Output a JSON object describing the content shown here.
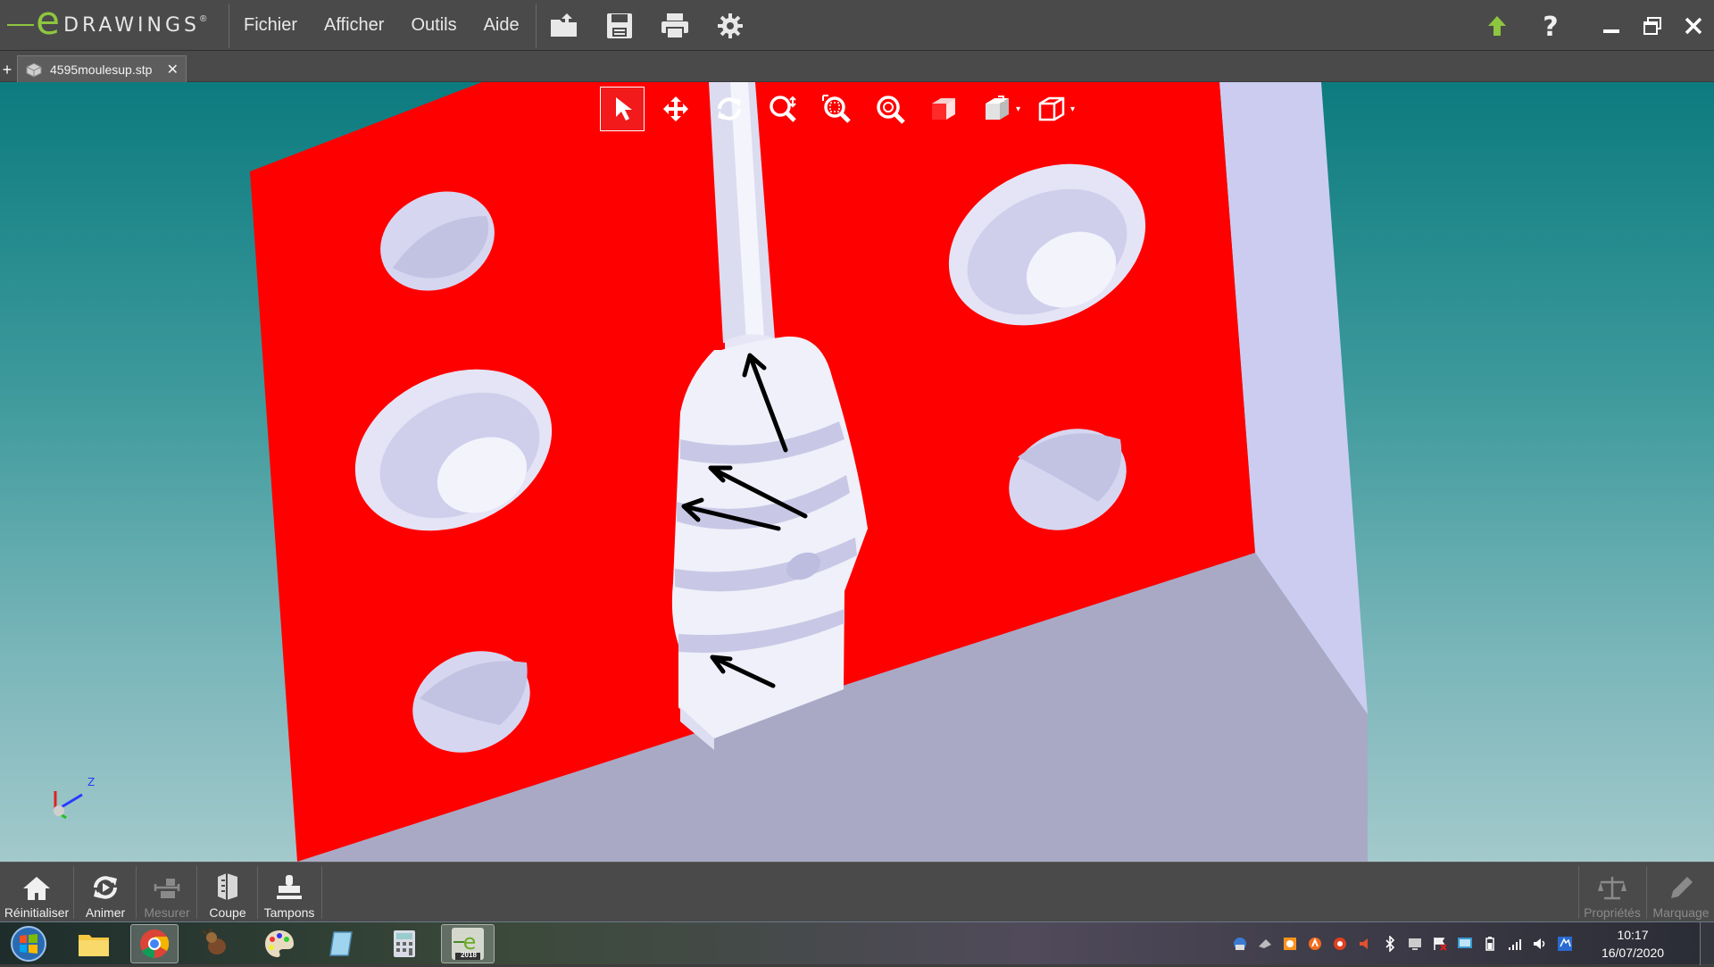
{
  "app": {
    "logo_text": "DRAWINGS",
    "logo_e": "e",
    "logo_mark": "®"
  },
  "menu": {
    "items": [
      "Fichier",
      "Afficher",
      "Outils",
      "Aide"
    ]
  },
  "toolbar": {
    "icons": [
      "open-icon",
      "save-icon",
      "print-icon",
      "settings-icon"
    ],
    "right_icons": [
      "upgrade-arrow-icon",
      "help-icon"
    ]
  },
  "window_controls": [
    "minimize-icon",
    "restore-icon",
    "close-icon"
  ],
  "tabs": {
    "new_tab": "+",
    "document": {
      "name": "4595moulesup.stp",
      "close": "✕"
    }
  },
  "view_toolbar": {
    "tools": [
      "select-icon",
      "pan-icon",
      "rotate-icon",
      "zoom-icon",
      "zoom-to-area-icon",
      "zoom-to-fit-icon",
      "shaded-view-icon",
      "standard-views-icon",
      "view-orientation-icon"
    ],
    "active": "select-icon",
    "dropdown_arrow": "▾"
  },
  "triad": {
    "z_label": "Z"
  },
  "scene": {
    "colors": {
      "block_face": "#ff0000",
      "block_side": "#ccccf0",
      "block_bottom": "#a9a9c6",
      "part": "#f0f0fa",
      "hole": "#d6d6f0"
    }
  },
  "command_bar": {
    "left": [
      {
        "label": "Réinitialiser",
        "icon": "home-icon",
        "enabled": true
      },
      {
        "label": "Animer",
        "icon": "animate-icon",
        "enabled": true
      },
      {
        "label": "Mesurer",
        "icon": "measure-icon",
        "enabled": false
      },
      {
        "label": "Coupe",
        "icon": "section-icon",
        "enabled": true
      },
      {
        "label": "Tampons",
        "icon": "stamp-icon",
        "enabled": true
      }
    ],
    "right": [
      {
        "label": "Propriétés",
        "icon": "properties-icon",
        "enabled": false
      },
      {
        "label": "Marquage",
        "icon": "markup-icon",
        "enabled": false
      }
    ]
  },
  "taskbar": {
    "apps": [
      "explorer-icon",
      "chrome-icon",
      "paint-dog-icon",
      "paint-palette-icon",
      "notepad-icon",
      "calculator-icon",
      "edrawings-icon"
    ],
    "active_app": "chrome-icon",
    "edrawings_badge": "2018",
    "clock_time": "10:17",
    "clock_date": "16/07/2020"
  }
}
